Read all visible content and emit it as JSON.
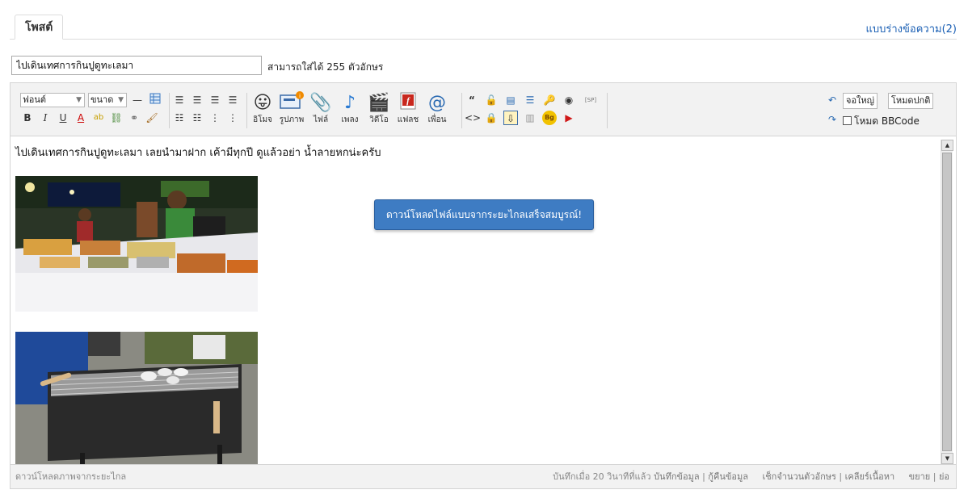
{
  "tabs": {
    "post_label": "โพสต์",
    "drafts_label": "แบบร่างข้อความ(2)"
  },
  "title_field": {
    "value": "ไปเดินเทศการกินปูดูทะเลมา",
    "hint": "สามารถใส่ได้ 255 ตัวอักษร"
  },
  "toolbar": {
    "font_select": "ฟอนต์",
    "size_select": "ขนาด",
    "emoji_label": "อิโมจ",
    "image_label": "รูปภาพ",
    "file_label": "ไฟล์",
    "music_label": "เพลง",
    "video_label": "วิดีโอ",
    "flash_label": "แฟลช",
    "friend_label": "เพื่อน",
    "sp_label": "[SP]",
    "bg_label": "Bg",
    "fullscreen_button": "จอใหญ่",
    "normal_mode_button": "โหมดปกติ",
    "bbcode_label": "โหมด BBCode"
  },
  "content": {
    "body_text": "ไปเดินเทศการกินปูดูทะเลมา เลยนำมาฝาก เค้ามีทุกปี ดูแล้วอย่า น้ำลายหกน่ะครับ",
    "toast": "ดาวน์โหลดไฟล์แบบจากระยะไกลเสร็จสมบูรณ์!"
  },
  "footer": {
    "remote_download": "ดาวน์โหลดภาพจากระยะไกล",
    "saved_status": "บันทึกเมื่อ 20 วินาทีที่แล้ว",
    "save_link": "บันทึกข้อมูล",
    "restore_link": "กู้คืนข้อมูล",
    "count_link": "เช็กจำนวนตัวอักษร",
    "clear_link": "เคลียร์เนื้อหา",
    "expand_link": "ขยาย",
    "shrink_link": "ย่อ"
  },
  "colors": {
    "accent": "#1a5fb4",
    "toast_bg": "#3e7cc3",
    "toolbar_bg": "#f2f2f2"
  }
}
